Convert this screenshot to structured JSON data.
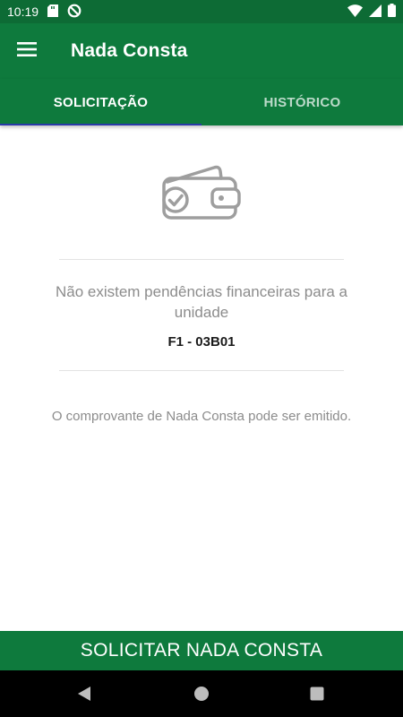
{
  "status_bar": {
    "time": "10:19"
  },
  "app_bar": {
    "title": "Nada Consta",
    "menu_icon": "hamburger-menu-icon"
  },
  "tabs": [
    {
      "label": "SOLICITAÇÃO",
      "active": true
    },
    {
      "label": "HISTÓRICO",
      "active": false
    }
  ],
  "main": {
    "icon": "wallet-check-icon",
    "message": "Não existem pendências financeiras para a unidade",
    "unit": "F1 - 03B01",
    "note": "O comprovante de Nada Consta pode ser emitido."
  },
  "action": {
    "label": "SOLICITAR NADA CONSTA"
  },
  "colors": {
    "primary": "#0e7a3d",
    "status_bar": "#0d6b35",
    "tab_indicator": "#2a3aa8",
    "muted_text": "#8c8c8c"
  }
}
